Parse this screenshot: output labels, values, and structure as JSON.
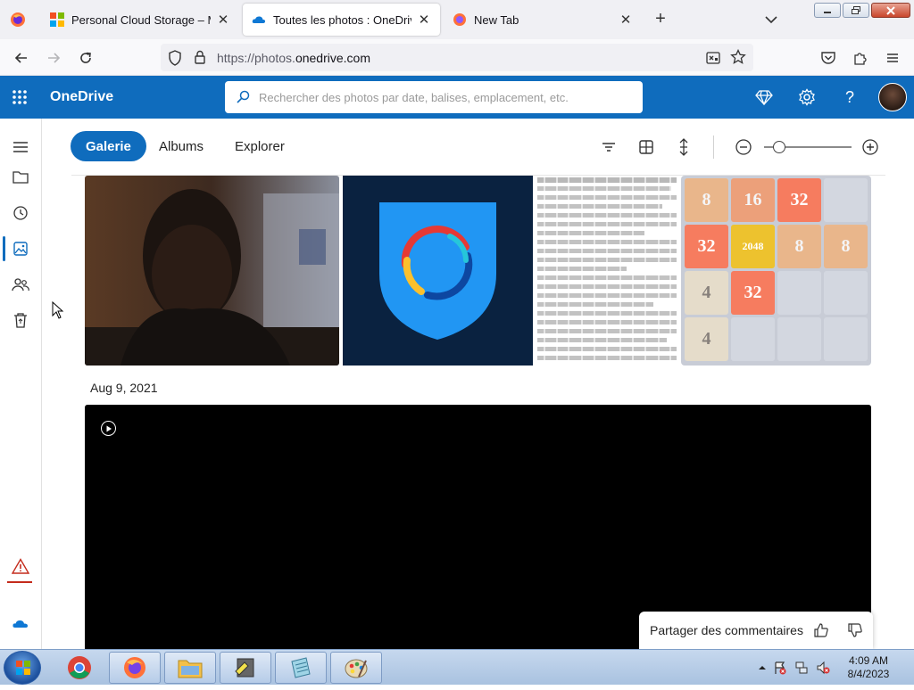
{
  "browser": {
    "tabs": [
      {
        "title": "Personal Cloud Storage – Micro",
        "close": "✕"
      },
      {
        "title": "Toutes les photos : OneDrive",
        "close": "✕"
      },
      {
        "title": "New Tab",
        "close": "✕"
      }
    ],
    "new_tab": "+",
    "url_prefix": "https://photos.",
    "url_domain": "onedrive.com"
  },
  "app": {
    "brand": "OneDrive",
    "search_placeholder": "Rechercher des photos par date, balises, emplacement, etc.",
    "help": "?"
  },
  "toolbar": {
    "pivots": [
      "Galerie",
      "Albums",
      "Explorer"
    ],
    "active_pivot": "Galerie"
  },
  "gallery": {
    "date_header": "Aug 9, 2021",
    "tiles": [
      {
        "name": "photo-portrait"
      },
      {
        "name": "photo-hotspot-shield"
      },
      {
        "name": "photo-text-scan"
      },
      {
        "name": "photo-2048-game",
        "cells": [
          "8",
          "16",
          "32",
          "",
          "32",
          "2048",
          "8",
          "8",
          "4",
          "32",
          "",
          "",
          "4",
          "",
          "",
          ""
        ]
      }
    ]
  },
  "feedback": {
    "label": "Partager des commentaires"
  },
  "taskbar": {
    "time": "4:09 AM",
    "date": "8/4/2023"
  },
  "colors": {
    "brand_blue": "#0f6cbd",
    "rail_warning": "#c42b1c"
  }
}
